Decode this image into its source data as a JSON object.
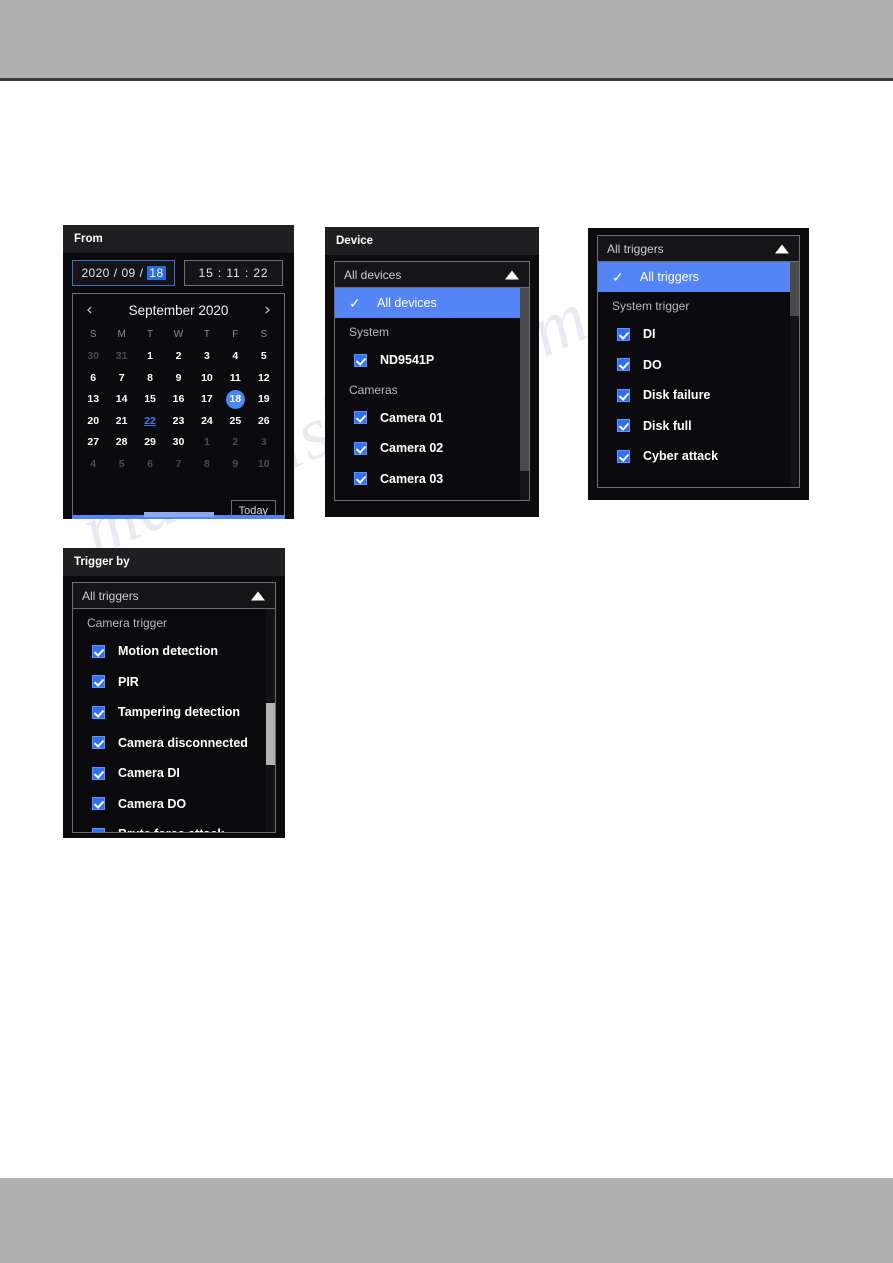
{
  "watermark": {
    "text": "manualshive.com"
  },
  "from_panel": {
    "title": "From",
    "date": {
      "year": "2020",
      "sep": "/",
      "month": "09",
      "day": "18"
    },
    "time": "15 : 11 : 22",
    "calendar": {
      "prev_icon": "‹",
      "next_icon": "›",
      "month_label": "September 2020",
      "dow": [
        "S",
        "M",
        "T",
        "W",
        "T",
        "F",
        "S"
      ],
      "weeks": [
        [
          {
            "d": "30",
            "state": "muted"
          },
          {
            "d": "31",
            "state": "muted"
          },
          {
            "d": "1",
            "state": "normal"
          },
          {
            "d": "2",
            "state": "normal"
          },
          {
            "d": "3",
            "state": "normal"
          },
          {
            "d": "4",
            "state": "normal"
          },
          {
            "d": "5",
            "state": "normal"
          }
        ],
        [
          {
            "d": "6",
            "state": "normal"
          },
          {
            "d": "7",
            "state": "normal"
          },
          {
            "d": "8",
            "state": "normal"
          },
          {
            "d": "9",
            "state": "normal"
          },
          {
            "d": "10",
            "state": "normal"
          },
          {
            "d": "11",
            "state": "normal"
          },
          {
            "d": "12",
            "state": "normal"
          }
        ],
        [
          {
            "d": "13",
            "state": "normal"
          },
          {
            "d": "14",
            "state": "normal"
          },
          {
            "d": "15",
            "state": "normal"
          },
          {
            "d": "16",
            "state": "normal"
          },
          {
            "d": "17",
            "state": "normal"
          },
          {
            "d": "18",
            "state": "selected"
          },
          {
            "d": "19",
            "state": "normal"
          }
        ],
        [
          {
            "d": "20",
            "state": "normal"
          },
          {
            "d": "21",
            "state": "normal"
          },
          {
            "d": "22",
            "state": "today"
          },
          {
            "d": "23",
            "state": "normal"
          },
          {
            "d": "24",
            "state": "normal"
          },
          {
            "d": "25",
            "state": "normal"
          },
          {
            "d": "26",
            "state": "normal"
          }
        ],
        [
          {
            "d": "27",
            "state": "normal"
          },
          {
            "d": "28",
            "state": "normal"
          },
          {
            "d": "29",
            "state": "normal"
          },
          {
            "d": "30",
            "state": "normal"
          },
          {
            "d": "1",
            "state": "muted"
          },
          {
            "d": "2",
            "state": "muted"
          },
          {
            "d": "3",
            "state": "muted"
          }
        ],
        [
          {
            "d": "4",
            "state": "muted"
          },
          {
            "d": "5",
            "state": "muted"
          },
          {
            "d": "6",
            "state": "muted"
          },
          {
            "d": "7",
            "state": "muted"
          },
          {
            "d": "8",
            "state": "muted"
          },
          {
            "d": "9",
            "state": "muted"
          },
          {
            "d": "10",
            "state": "muted"
          }
        ]
      ],
      "today_button": "Today"
    }
  },
  "device_panel": {
    "title": "Device",
    "select_value": "All devices",
    "caret_icon": "caret-up-icon",
    "options": [
      {
        "type": "option",
        "label": "All devices",
        "selected": true,
        "tick": "✓"
      },
      {
        "type": "group",
        "label": "System"
      },
      {
        "type": "checkbox",
        "label": "ND9541P",
        "checked": true
      },
      {
        "type": "group",
        "label": "Cameras"
      },
      {
        "type": "checkbox",
        "label": "Camera 01",
        "checked": true
      },
      {
        "type": "checkbox",
        "label": "Camera 02",
        "checked": true
      },
      {
        "type": "checkbox",
        "label": "Camera 03",
        "checked": true
      }
    ]
  },
  "system_panel": {
    "select_value": "All triggers",
    "caret_icon": "caret-up-icon",
    "options": [
      {
        "type": "option",
        "label": "All triggers",
        "selected": true,
        "tick": "✓"
      },
      {
        "type": "group",
        "label": "System trigger"
      },
      {
        "type": "checkbox",
        "label": "DI",
        "checked": true
      },
      {
        "type": "checkbox",
        "label": "DO",
        "checked": true
      },
      {
        "type": "checkbox",
        "label": "Disk failure",
        "checked": true
      },
      {
        "type": "checkbox",
        "label": "Disk full",
        "checked": true
      },
      {
        "type": "checkbox",
        "label": "Cyber attack",
        "checked": true
      }
    ]
  },
  "triggerby_panel": {
    "title": "Trigger by",
    "select_value": "All triggers",
    "caret_icon": "caret-up-icon",
    "options": [
      {
        "type": "group",
        "label": "Camera trigger"
      },
      {
        "type": "checkbox",
        "label": "Motion detection",
        "checked": true
      },
      {
        "type": "checkbox",
        "label": "PIR",
        "checked": true
      },
      {
        "type": "checkbox",
        "label": "Tampering detection",
        "checked": true
      },
      {
        "type": "checkbox",
        "label": "Camera disconnected",
        "checked": true
      },
      {
        "type": "checkbox",
        "label": "Camera DI",
        "checked": true
      },
      {
        "type": "checkbox",
        "label": "Camera DO",
        "checked": true
      },
      {
        "type": "checkbox",
        "label": "Brute force attack",
        "checked": true
      }
    ]
  }
}
